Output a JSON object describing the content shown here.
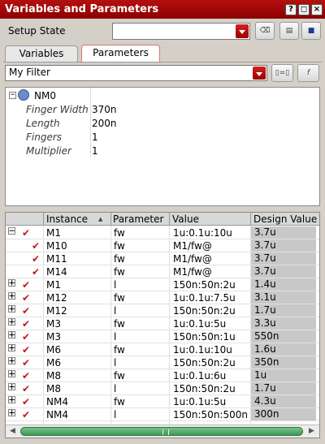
{
  "window": {
    "title": "Variables and Parameters"
  },
  "setup_state": {
    "label": "Setup State",
    "value": ""
  },
  "tabs": [
    {
      "label": "Variables"
    },
    {
      "label": "Parameters"
    }
  ],
  "filter": {
    "value": "My Filter"
  },
  "tree": {
    "node_label": "NM0",
    "properties": [
      {
        "key": "Finger Width",
        "value": "370n"
      },
      {
        "key": "Length",
        "value": "200n"
      },
      {
        "key": "Fingers",
        "value": "1"
      },
      {
        "key": "Multiplier",
        "value": "1"
      }
    ]
  },
  "table": {
    "headers": {
      "instance": "Instance",
      "parameter": "Parameter",
      "value": "Value",
      "design_value": "Design Value"
    },
    "rows": [
      {
        "instance": "M1",
        "parameter": "fw",
        "value": "1u:0.1u:10u",
        "design_value": "3.7u"
      },
      {
        "instance": "M10",
        "parameter": "fw",
        "value": "M1/fw@",
        "design_value": "3.7u"
      },
      {
        "instance": "M11",
        "parameter": "fw",
        "value": "M1/fw@",
        "design_value": "3.7u"
      },
      {
        "instance": "M14",
        "parameter": "fw",
        "value": "M1/fw@",
        "design_value": "3.7u"
      },
      {
        "instance": "M1",
        "parameter": "l",
        "value": "150n:50n:2u",
        "design_value": "1.4u"
      },
      {
        "instance": "M12",
        "parameter": "fw",
        "value": "1u:0.1u:7.5u",
        "design_value": "3.1u"
      },
      {
        "instance": "M12",
        "parameter": "l",
        "value": "150n:50n:2u",
        "design_value": "1.7u"
      },
      {
        "instance": "M3",
        "parameter": "fw",
        "value": "1u:0.1u:5u",
        "design_value": "3.3u"
      },
      {
        "instance": "M3",
        "parameter": "l",
        "value": "150n:50n:1u",
        "design_value": "550n"
      },
      {
        "instance": "M6",
        "parameter": "fw",
        "value": "1u:0.1u:10u",
        "design_value": "1.6u"
      },
      {
        "instance": "M6",
        "parameter": "l",
        "value": "150n:50n:2u",
        "design_value": "350n"
      },
      {
        "instance": "M8",
        "parameter": "fw",
        "value": "1u:0.1u:6u",
        "design_value": "1u"
      },
      {
        "instance": "M8",
        "parameter": "l",
        "value": "150n:50n:2u",
        "design_value": "1.7u"
      },
      {
        "instance": "NM4",
        "parameter": "fw",
        "value": "1u:0.1u:5u",
        "design_value": "4.3u"
      },
      {
        "instance": "NM4",
        "parameter": "l",
        "value": "150n:50n:500n",
        "design_value": "300n"
      }
    ]
  },
  "colors": {
    "title_bar": "#8c0000",
    "check": "#c01818",
    "scroll_thumb": "#3f9a56"
  }
}
